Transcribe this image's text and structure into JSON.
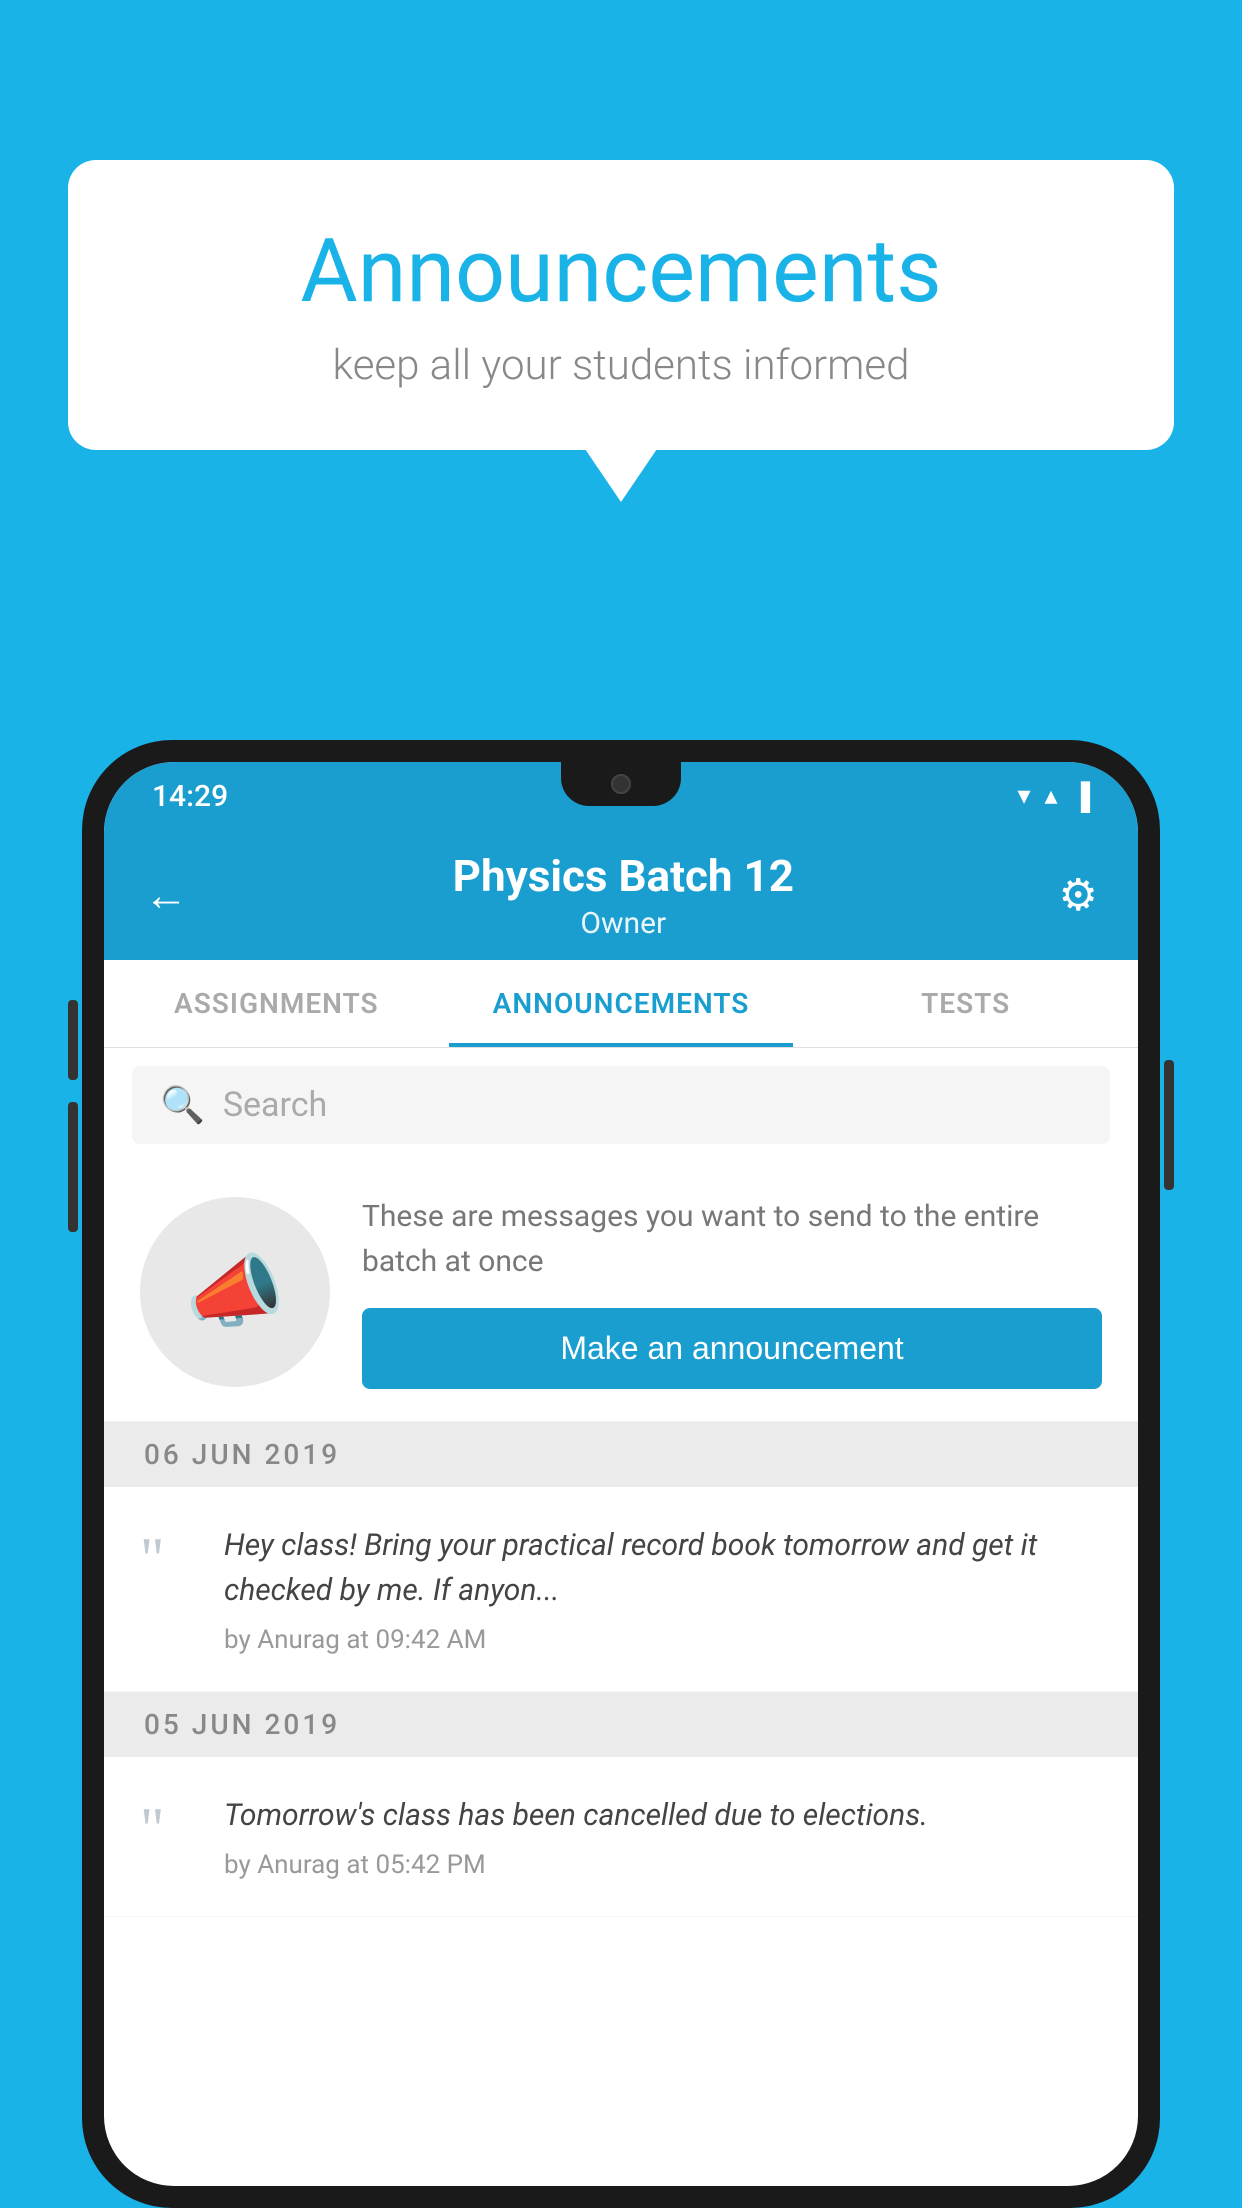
{
  "background_color": "#1ab3e8",
  "speech_bubble": {
    "title": "Announcements",
    "subtitle": "keep all your students informed"
  },
  "phone": {
    "status_bar": {
      "time": "14:29",
      "wifi": "▼",
      "signal": "▲",
      "battery": "▐"
    },
    "header": {
      "title": "Physics Batch 12",
      "subtitle": "Owner",
      "back_label": "←",
      "gear_label": "⚙"
    },
    "tabs": [
      {
        "label": "ASSIGNMENTS",
        "active": false
      },
      {
        "label": "ANNOUNCEMENTS",
        "active": true
      },
      {
        "label": "TESTS",
        "active": false
      }
    ],
    "search": {
      "placeholder": "Search"
    },
    "announcement_prompt": {
      "description": "These are messages you want to send to the entire batch at once",
      "button_label": "Make an announcement"
    },
    "announcements": [
      {
        "date": "06  JUN  2019",
        "text": "Hey class! Bring your practical record book tomorrow and get it checked by me. If anyon...",
        "meta": "by Anurag at 09:42 AM"
      },
      {
        "date": "05  JUN  2019",
        "text": "Tomorrow's class has been cancelled due to elections.",
        "meta": "by Anurag at 05:42 PM"
      }
    ]
  }
}
